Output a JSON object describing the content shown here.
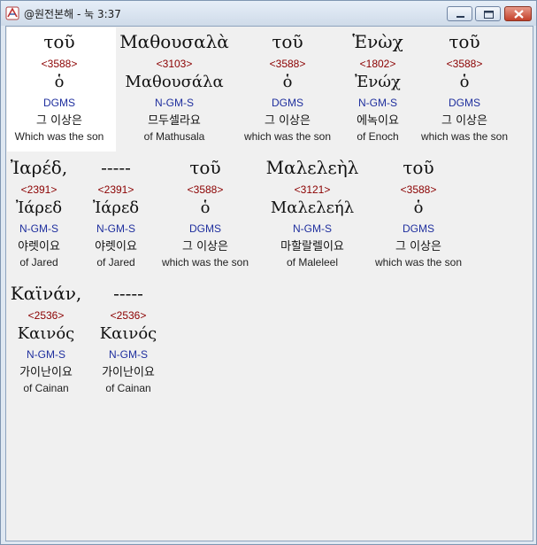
{
  "window": {
    "title": "@원전본해 - 눅 3:37"
  },
  "rows": [
    [
      {
        "greek": "τοῦ",
        "strong": "<3588>",
        "lemma": "ὁ",
        "morph": "DGMS",
        "korean": "그 이상은",
        "english": "Which was the son"
      },
      {
        "greek": "Μαθουσαλὰ",
        "strong": "<3103>",
        "lemma": "Μαθουσάλα",
        "morph": "N-GM-S",
        "korean": "므두셀라요",
        "english": "of Mathusala"
      },
      {
        "greek": "τοῦ",
        "strong": "<3588>",
        "lemma": "ὁ",
        "morph": "DGMS",
        "korean": "그 이상은",
        "english": "which was the son"
      },
      {
        "greek": "Ἑνὼχ",
        "strong": "<1802>",
        "lemma": "Ἐνώχ",
        "morph": "N-GM-S",
        "korean": "에녹이요",
        "english": "of Enoch"
      },
      {
        "greek": "τοῦ",
        "strong": "<3588>",
        "lemma": "ὁ",
        "morph": "DGMS",
        "korean": "그 이상은",
        "english": "which was the son"
      }
    ],
    [
      {
        "greek": "Ἰαρέδ,",
        "strong": "<2391>",
        "lemma": "Ἰάρεδ",
        "morph": "N-GM-S",
        "korean": "야렛이요",
        "english": "of Jared"
      },
      {
        "greek": "-----",
        "strong": "<2391>",
        "lemma": "Ἰάρεδ",
        "morph": "N-GM-S",
        "korean": "야렛이요",
        "english": "of Jared"
      },
      {
        "greek": "τοῦ",
        "strong": "<3588>",
        "lemma": "ὁ",
        "morph": "DGMS",
        "korean": "그 이상은",
        "english": "which was the son"
      },
      {
        "greek": "Μαλελεὴλ",
        "strong": "<3121>",
        "lemma": "Μαλελεήλ",
        "morph": "N-GM-S",
        "korean": "마할랄렐이요",
        "english": "of Maleleel"
      },
      {
        "greek": "τοῦ",
        "strong": "<3588>",
        "lemma": "ὁ",
        "morph": "DGMS",
        "korean": "그 이상은",
        "english": "which was the son"
      }
    ],
    [
      {
        "greek": "Καϊνάν,",
        "strong": "<2536>",
        "lemma": "Καινός",
        "morph": "N-GM-S",
        "korean": "가이난이요",
        "english": "of Cainan"
      },
      {
        "greek": "-----",
        "strong": "<2536>",
        "lemma": "Καινός",
        "morph": "N-GM-S",
        "korean": "가이난이요",
        "english": "of Cainan"
      }
    ]
  ]
}
